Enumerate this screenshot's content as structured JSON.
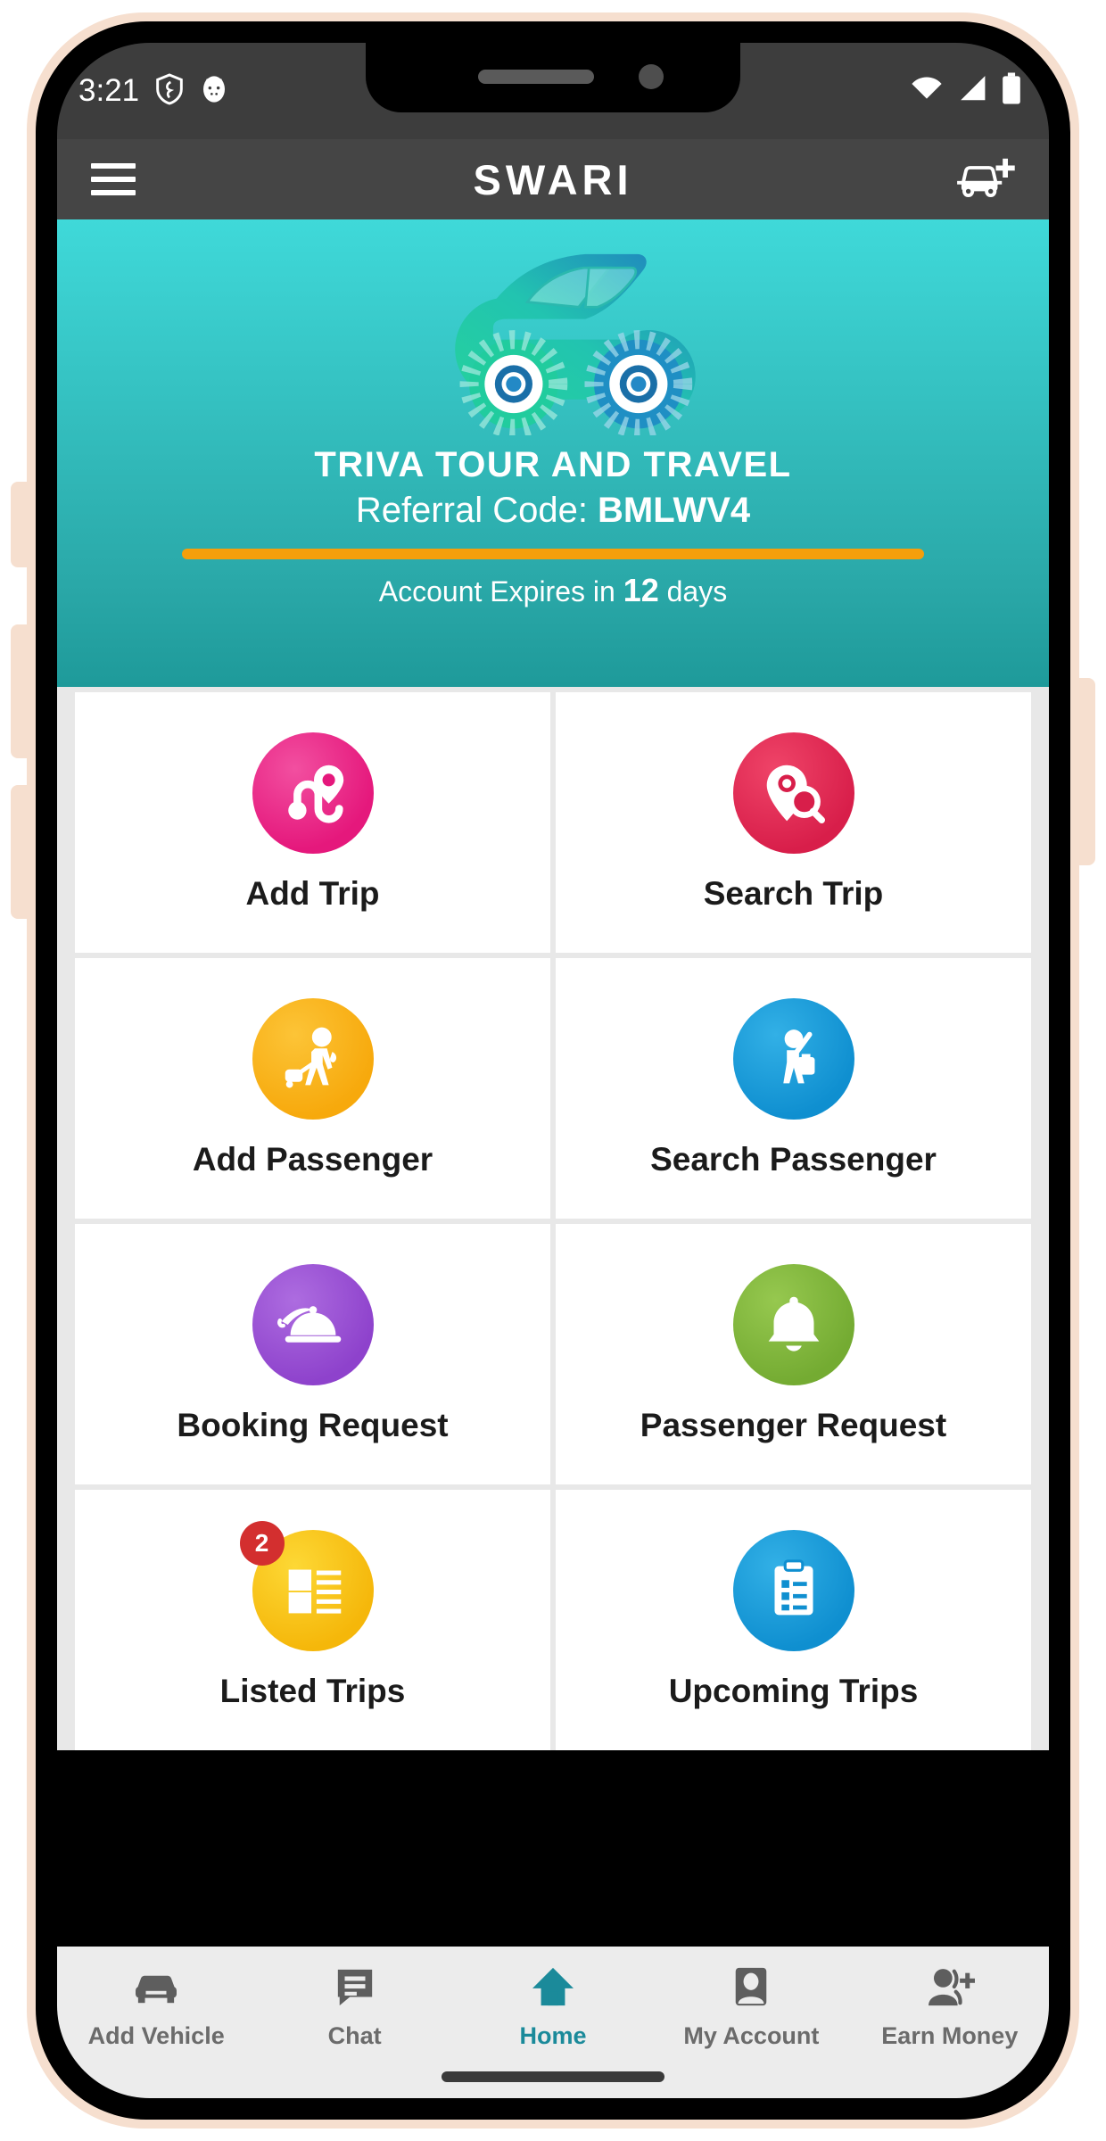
{
  "status_bar": {
    "time": "3:21",
    "icons": [
      "shield-icon",
      "app-notification-icon",
      "wifi-icon",
      "signal-icon",
      "battery-icon"
    ]
  },
  "app_bar": {
    "menu_icon": "hamburger-menu-icon",
    "title": "SWARI",
    "action_icon": "add-vehicle-icon"
  },
  "hero": {
    "logo_icon": "car-logo",
    "company_name": "TRIVA TOUR AND TRAVEL",
    "referral_label": "Referral Code: ",
    "referral_code": "BMLWV4",
    "expiry_prefix": "Account Expires in ",
    "expiry_days": "12",
    "expiry_suffix": " days",
    "progress_color": "#f59f0b",
    "bg_color_top": "#3fd9d9",
    "bg_color_bottom": "#1e9a9a"
  },
  "grid": {
    "tiles": [
      {
        "label": "Add Trip",
        "icon": "route-pin-icon",
        "color": "#ea1e79",
        "badge": null
      },
      {
        "label": "Search Trip",
        "icon": "pin-search-icon",
        "color": "#e02b52",
        "badge": null
      },
      {
        "label": "Add Passenger",
        "icon": "traveler-icon",
        "color": "#f9b117",
        "badge": null
      },
      {
        "label": "Search Passenger",
        "icon": "passenger-hail-icon",
        "color": "#1b9ddb",
        "badge": null
      },
      {
        "label": "Booking Request",
        "icon": "bell-service-icon",
        "color": "#9c54d5",
        "badge": null
      },
      {
        "label": "Passenger Request",
        "icon": "bell-icon",
        "color": "#7cb342",
        "badge": null
      },
      {
        "label": "Listed Trips",
        "icon": "list-icon",
        "color": "#f9c30d",
        "badge": "2"
      },
      {
        "label": "Upcoming Trips",
        "icon": "clipboard-icon",
        "color": "#1b9ddb",
        "badge": null
      }
    ]
  },
  "bottom_nav": {
    "items": [
      {
        "label": "Add Vehicle",
        "icon": "car-icon",
        "active": false
      },
      {
        "label": "Chat",
        "icon": "chat-icon",
        "active": false
      },
      {
        "label": "Home",
        "icon": "home-icon",
        "active": true
      },
      {
        "label": "My Account",
        "icon": "account-icon",
        "active": false
      },
      {
        "label": "Earn Money",
        "icon": "add-person-icon",
        "active": false
      }
    ],
    "active_color": "#1b8a9a",
    "inactive_color": "#6b6b6b"
  }
}
